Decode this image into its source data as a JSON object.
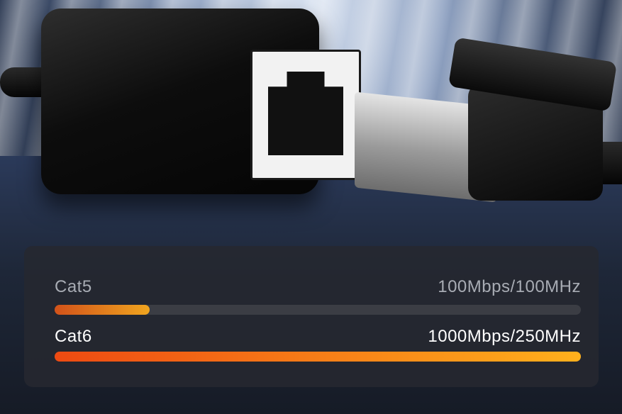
{
  "speeds": [
    {
      "label": "Cat5",
      "spec": "100Mbps/100MHz",
      "level": 0.18,
      "accent": "#f0a51f"
    },
    {
      "label": "Cat6",
      "spec": "1000Mbps/250MHz",
      "level": 1.0,
      "accent": "#ff8a1a"
    }
  ],
  "photo": {
    "subject_icons": [
      "ethernet-coupler",
      "rj45-plug"
    ]
  }
}
